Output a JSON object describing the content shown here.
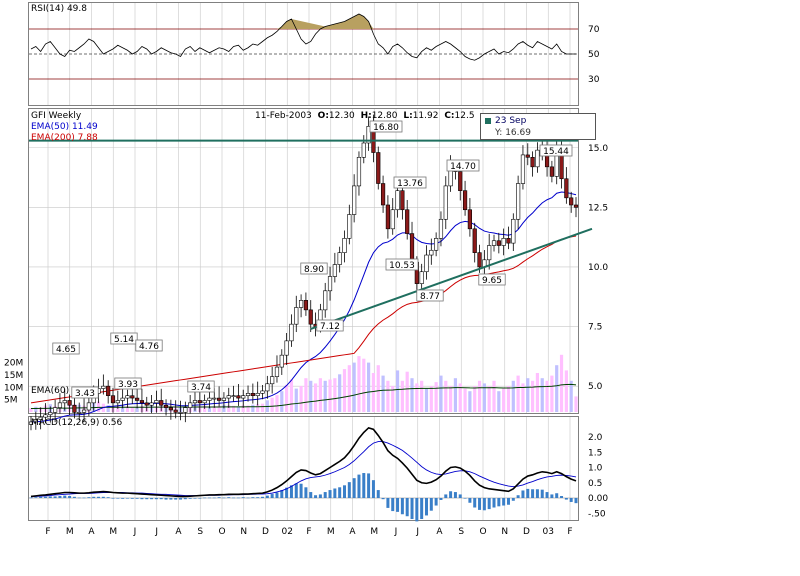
{
  "chart_data": {
    "type": "candlestick",
    "symbol_title": "GFI Weekly",
    "ohlc_header": {
      "date": "11-Feb-2003",
      "open_label": "O:",
      "open": "12.30",
      "high_label": "H:",
      "high": "12.80",
      "low_label": "L:",
      "low": "11.92",
      "close_label": "C:",
      "close": "12.5"
    },
    "ema50_label": "EMA(50) 11.49",
    "ema200_label": "EMA(200) 7.88",
    "ema60_label": "EMA(60)",
    "rsi_label": "RSI(14) 49.8",
    "macd_label": "MACD(12,26,9) 0.56",
    "tooltip": {
      "date": "23 Sep",
      "y": "Y: 16.69"
    },
    "colors": {
      "up": "#ffffff",
      "down": "#8b1a1a",
      "ema50": "#0000cc",
      "ema200": "#cc0000",
      "trend": "#1f6f5f",
      "volume": "#ffc0ff",
      "volume_alt": "#c0c0ff",
      "macd_hist": "#3a7fc8",
      "rsi_fill": "#b8a060",
      "frame": "#808080"
    },
    "price_axis": {
      "min": 4.0,
      "max": 16.5,
      "ticks": [
        "15.0",
        "12.5",
        "10.0",
        "7.5",
        "5.0"
      ]
    },
    "volume_axis": {
      "ticks": [
        "20M",
        "15M",
        "10M",
        "5M"
      ]
    },
    "rsi_axis": {
      "ticks": [
        "70",
        "50",
        "30"
      ]
    },
    "macd_axis": {
      "ticks": [
        "2.0",
        "1.5",
        "1.0",
        "0.5",
        "0.00",
        "-.50"
      ]
    },
    "x_labels": [
      "F",
      "M",
      "A",
      "M",
      "J",
      "J",
      "A",
      "S",
      "O",
      "N",
      "D",
      "02",
      "F",
      "M",
      "A",
      "M",
      "J",
      "J",
      "A",
      "S",
      "O",
      "N",
      "D",
      "03",
      "F"
    ],
    "price_annotations": [
      "4.65",
      "3.43",
      "5.14",
      "3.93",
      "4.76",
      "3.74",
      "8.90",
      "7.12",
      "16.80",
      "13.76",
      "10.53",
      "8.77",
      "14.70",
      "9.65",
      "15.44"
    ],
    "resistance_level": 15.3,
    "support_trendline": {
      "from": [
        7.4
      ],
      "to": [
        11.6
      ]
    },
    "closes": [
      3.5,
      3.6,
      3.7,
      3.8,
      3.9,
      4.1,
      4.3,
      4.4,
      4.2,
      3.9,
      3.9,
      4.0,
      4.3,
      4.7,
      4.9,
      5.0,
      4.6,
      4.3,
      4.4,
      4.5,
      4.6,
      4.5,
      4.4,
      4.3,
      4.2,
      4.3,
      4.4,
      4.2,
      4.1,
      4.0,
      3.9,
      3.9,
      4.1,
      4.3,
      4.4,
      4.3,
      4.4,
      4.5,
      4.5,
      4.4,
      4.5,
      4.6,
      4.6,
      4.5,
      4.6,
      4.7,
      4.6,
      4.7,
      4.8,
      5.1,
      5.4,
      5.8,
      6.3,
      6.9,
      7.6,
      8.3,
      8.6,
      8.2,
      7.6,
      7.5,
      8.2,
      9.0,
      9.6,
      10.1,
      10.6,
      11.2,
      12.2,
      13.4,
      14.6,
      15.2,
      15.9,
      14.8,
      13.5,
      12.6,
      11.6,
      12.4,
      13.2,
      12.4,
      11.4,
      10.2,
      9.3,
      9.8,
      10.5,
      10.7,
      11.2,
      12.0,
      13.4,
      14.2,
      14.0,
      13.2,
      12.4,
      11.6,
      10.6,
      10.0,
      10.3,
      10.9,
      11.1,
      10.9,
      11.2,
      11.0,
      12.0,
      13.5,
      14.7,
      14.6,
      14.2,
      14.9,
      14.8,
      14.2,
      13.8,
      15.1,
      13.7,
      12.9,
      12.6,
      12.5
    ],
    "volumes": [
      1.5,
      2.0,
      1.8,
      2.5,
      3.0,
      2.2,
      2.0,
      1.6,
      2.6,
      3.0,
      2.8,
      2.4,
      2.8,
      3.5,
      4.0,
      3.2,
      2.6,
      2.0,
      2.4,
      2.5,
      2.2,
      2.0,
      1.8,
      2.3,
      2.0,
      2.5,
      2.0,
      2.8,
      3.0,
      2.5,
      2.2,
      2.0,
      1.8,
      2.4,
      2.0,
      2.2,
      2.5,
      2.0,
      2.2,
      2.4,
      2.8,
      2.6,
      2.4,
      2.2,
      2.6,
      2.5,
      2.8,
      3.0,
      3.2,
      4.5,
      5.5,
      6.5,
      8.0,
      10.5,
      12.5,
      9.0,
      10.0,
      13.0,
      12.0,
      11.0,
      13.0,
      12.0,
      12.5,
      13.0,
      14.5,
      16.5,
      18.0,
      19.0,
      21.5,
      20.5,
      19.0,
      15.0,
      18.0,
      14.0,
      12.0,
      10.0,
      16.0,
      12.0,
      15.5,
      13.0,
      11.0,
      12.0,
      9.0,
      10.0,
      11.5,
      14.0,
      12.0,
      10.0,
      13.0,
      11.0,
      9.0,
      8.0,
      10.0,
      12.0,
      11.0,
      10.0,
      12.0,
      8.0,
      9.0,
      10.0,
      12.0,
      14.0,
      11.0,
      13.0,
      12.0,
      15.0,
      13.0,
      12.0,
      14.0,
      18.0,
      22.0,
      16.0,
      12.0,
      6.0
    ],
    "rsi": [
      54,
      56,
      52,
      58,
      60,
      55,
      50,
      48,
      53,
      52,
      55,
      58,
      62,
      60,
      55,
      50,
      52,
      54,
      57,
      55,
      53,
      50,
      52,
      56,
      54,
      50,
      52,
      55,
      53,
      51,
      50,
      48,
      54,
      56,
      52,
      55,
      53,
      51,
      53,
      55,
      54,
      52,
      56,
      57,
      53,
      55,
      58,
      57,
      60,
      63,
      65,
      68,
      72,
      76,
      78,
      70,
      62,
      58,
      60,
      66,
      70,
      72,
      73,
      74,
      75,
      76,
      78,
      80,
      82,
      80,
      76,
      66,
      58,
      55,
      50,
      56,
      58,
      55,
      51,
      48,
      47,
      52,
      55,
      53,
      56,
      58,
      60,
      58,
      55,
      52,
      48,
      46,
      45,
      47,
      50,
      52,
      54,
      50,
      52,
      51,
      54,
      58,
      60,
      57,
      55,
      60,
      58,
      56,
      54,
      58,
      52,
      50,
      50,
      50
    ],
    "macd": [
      0.05,
      0.07,
      0.09,
      0.1,
      0.12,
      0.14,
      0.16,
      0.18,
      0.18,
      0.17,
      0.16,
      0.16,
      0.17,
      0.19,
      0.2,
      0.21,
      0.2,
      0.18,
      0.17,
      0.16,
      0.16,
      0.15,
      0.14,
      0.13,
      0.12,
      0.11,
      0.1,
      0.09,
      0.08,
      0.07,
      0.06,
      0.05,
      0.05,
      0.06,
      0.07,
      0.08,
      0.09,
      0.1,
      0.1,
      0.11,
      0.11,
      0.12,
      0.12,
      0.12,
      0.13,
      0.13,
      0.14,
      0.15,
      0.16,
      0.2,
      0.26,
      0.34,
      0.44,
      0.56,
      0.7,
      0.84,
      0.92,
      0.9,
      0.82,
      0.76,
      0.8,
      0.9,
      1.0,
      1.1,
      1.2,
      1.32,
      1.5,
      1.72,
      1.96,
      2.15,
      2.3,
      2.25,
      2.05,
      1.82,
      1.55,
      1.4,
      1.3,
      1.15,
      0.98,
      0.78,
      0.58,
      0.5,
      0.48,
      0.52,
      0.6,
      0.72,
      0.88,
      1.0,
      1.02,
      0.98,
      0.88,
      0.74,
      0.56,
      0.42,
      0.34,
      0.3,
      0.28,
      0.26,
      0.24,
      0.22,
      0.3,
      0.46,
      0.62,
      0.72,
      0.76,
      0.82,
      0.86,
      0.84,
      0.8,
      0.86,
      0.8,
      0.7,
      0.62,
      0.56
    ],
    "macd_signal": [
      0.04,
      0.05,
      0.06,
      0.07,
      0.08,
      0.1,
      0.11,
      0.12,
      0.13,
      0.14,
      0.15,
      0.15,
      0.15,
      0.16,
      0.17,
      0.18,
      0.18,
      0.18,
      0.18,
      0.18,
      0.17,
      0.17,
      0.16,
      0.16,
      0.15,
      0.14,
      0.13,
      0.12,
      0.12,
      0.11,
      0.1,
      0.09,
      0.08,
      0.08,
      0.08,
      0.08,
      0.08,
      0.09,
      0.09,
      0.09,
      0.1,
      0.1,
      0.11,
      0.11,
      0.11,
      0.12,
      0.12,
      0.13,
      0.13,
      0.14,
      0.16,
      0.2,
      0.24,
      0.3,
      0.38,
      0.47,
      0.56,
      0.63,
      0.67,
      0.69,
      0.71,
      0.75,
      0.8,
      0.86,
      0.93,
      1.0,
      1.1,
      1.22,
      1.37,
      1.52,
      1.68,
      1.8,
      1.85,
      1.85,
      1.8,
      1.73,
      1.65,
      1.56,
      1.44,
      1.31,
      1.17,
      1.03,
      0.92,
      0.84,
      0.79,
      0.77,
      0.79,
      0.83,
      0.87,
      0.89,
      0.89,
      0.86,
      0.8,
      0.72,
      0.65,
      0.58,
      0.52,
      0.47,
      0.43,
      0.39,
      0.37,
      0.39,
      0.43,
      0.49,
      0.54,
      0.6,
      0.65,
      0.69,
      0.71,
      0.74,
      0.75,
      0.74,
      0.72,
      0.69
    ]
  }
}
